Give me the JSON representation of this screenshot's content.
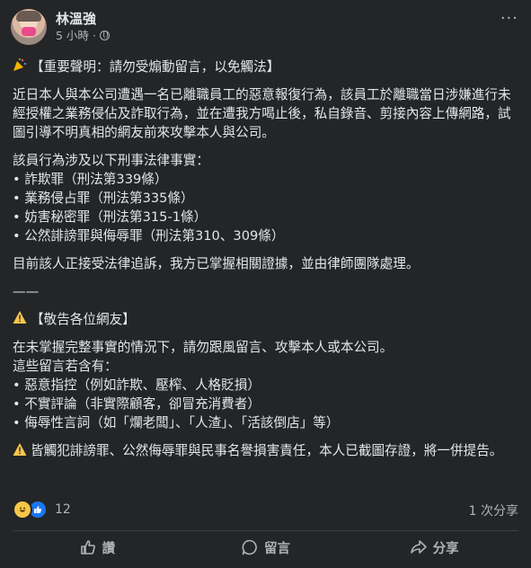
{
  "author": {
    "name": "林溫強",
    "time": "5 小時",
    "dot": "·",
    "privacy_icon": "globe-icon"
  },
  "more_icon": "···",
  "content": {
    "title_icon": "party-popper-icon",
    "title": "【重要聲明：請勿受煽動留言，以免觸法】",
    "para1": "近日本人與本公司遭遇一名已離職員工的惡意報復行為，該員工於離職當日涉嫌進行未經授權之業務侵佔及詐取行為，並在遭我方喝止後，私自錄音、剪接內容上傳網路，試圖引導不明真相的網友前來攻擊本人與公司。",
    "para2_intro": "該員行為涉及以下刑事法律事實：",
    "charges": [
      "• 詐欺罪（刑法第339條）",
      "• 業務侵占罪（刑法第335條）",
      "• 妨害秘密罪（刑法第315-1條）",
      "• 公然誹謗罪與侮辱罪（刑法第310、309條）"
    ],
    "para3": "目前該人正接受法律追訴，我方已掌握相關證據，並由律師團隊處理。",
    "separator": "——",
    "warning_title": "【敬告各位網友】",
    "para4": "在未掌握完整事實的情況下，請勿跟風留言、攻擊本人或本公司。",
    "para5_intro": "這些留言若含有：",
    "items": [
      "• 惡意指控（例如詐欺、壓榨、人格貶損）",
      "• 不實評論（非實際顧客，卻冒充消費者）",
      "• 侮辱性言詞（如「爛老闆」、「人渣」、「活該倒店」等）"
    ],
    "final": "皆觸犯誹謗罪、公然侮辱罪與民事名譽損害責任，本人已截圖存證，將一併提告。"
  },
  "stats": {
    "reaction_count": "12",
    "shares": "1 次分享"
  },
  "actions": {
    "like": "讚",
    "comment": "留言",
    "share": "分享"
  }
}
